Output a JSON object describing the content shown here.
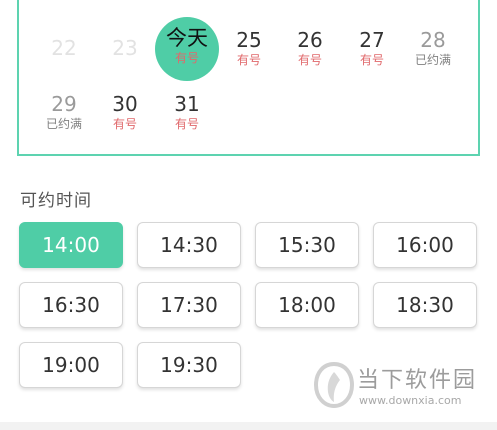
{
  "calendar": {
    "days": [
      {
        "num": "22",
        "status": "",
        "state": "past"
      },
      {
        "num": "23",
        "status": "",
        "state": "past"
      },
      {
        "num": "今天",
        "status": "有号",
        "state": "today"
      },
      {
        "num": "25",
        "status": "有号",
        "state": "avail"
      },
      {
        "num": "26",
        "status": "有号",
        "state": "avail"
      },
      {
        "num": "27",
        "status": "有号",
        "state": "avail"
      },
      {
        "num": "28",
        "status": "已约满",
        "state": "full"
      },
      {
        "num": "29",
        "status": "已约满",
        "state": "full"
      },
      {
        "num": "30",
        "status": "有号",
        "state": "avail"
      },
      {
        "num": "31",
        "status": "有号",
        "state": "avail"
      }
    ]
  },
  "times": {
    "title": "可约时间",
    "selected": "14:00",
    "slots": [
      "14:00",
      "14:30",
      "15:30",
      "16:00",
      "16:30",
      "17:30",
      "18:00",
      "18:30",
      "19:00",
      "19:30"
    ]
  },
  "watermark": {
    "name": "当下软件园",
    "url": "www.downxia.com"
  },
  "colors": {
    "accent": "#4fcda6",
    "available": "#e0686b",
    "border": "#5dd3b0"
  }
}
